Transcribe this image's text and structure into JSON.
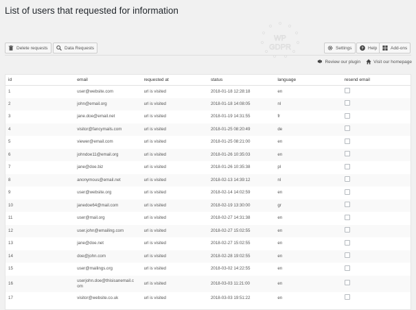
{
  "header": {
    "title": "List of users that requested for information",
    "logo_text_1": "WP",
    "logo_text_2": "GDPR"
  },
  "toolbar": {
    "delete_label": "Delete requests",
    "data_requests_label": "Data Requests",
    "settings_label": "Settings",
    "help_label": "Help",
    "addons_label": "Add-ons"
  },
  "links": {
    "review_label": "Review our plugin",
    "homepage_label": "Visit our homepage"
  },
  "table": {
    "columns": [
      "id",
      "email",
      "requested at",
      "status",
      "language",
      "resend email"
    ],
    "rows": [
      {
        "id": "1",
        "email": "user@website.com",
        "requested": "url is visited",
        "status": "2018-01-18 12:28:18",
        "language": "en"
      },
      {
        "id": "2",
        "email": "john@email.org",
        "requested": "url is visited",
        "status": "2018-01-18 14:08:05",
        "language": "nl"
      },
      {
        "id": "3",
        "email": "jane.doe@email.net",
        "requested": "url is visited",
        "status": "2018-01-19 14:31:55",
        "language": "fr"
      },
      {
        "id": "4",
        "email": "visitor@fancymails.com",
        "requested": "url is visited",
        "status": "2018-01-25 08:20:49",
        "language": "de"
      },
      {
        "id": "5",
        "email": "viewer@email.com",
        "requested": "url is visited",
        "status": "2018-01-25 08:21:00",
        "language": "en"
      },
      {
        "id": "6",
        "email": "johndoe11@email.org",
        "requested": "url is visited",
        "status": "2018-01-26 10:35:03",
        "language": "en"
      },
      {
        "id": "7",
        "email": "jane@doe.biz",
        "requested": "url is visited",
        "status": "2018-01-26 10:35:38",
        "language": "pl"
      },
      {
        "id": "8",
        "email": "anonymous@email.net",
        "requested": "url is visited",
        "status": "2018-02-13 14:39:12",
        "language": "nl"
      },
      {
        "id": "9",
        "email": "user@website.org",
        "requested": "url is visited",
        "status": "2018-02-14 14:02:59",
        "language": "en"
      },
      {
        "id": "10",
        "email": "janedoe64@mail.com",
        "requested": "url is visited",
        "status": "2018-02-19 13:30:00",
        "language": "gr"
      },
      {
        "id": "11",
        "email": "user@mail.org",
        "requested": "url is visited",
        "status": "2018-02-27 14:31:38",
        "language": "en"
      },
      {
        "id": "12",
        "email": "user.john@emailing.com",
        "requested": "url is visited",
        "status": "2018-02-27 15:02:55",
        "language": "en"
      },
      {
        "id": "13",
        "email": "jane@doe.net",
        "requested": "url is visited",
        "status": "2018-02-27 15:02:55",
        "language": "en"
      },
      {
        "id": "14",
        "email": "doe@john.com",
        "requested": "url is visited",
        "status": "2018-02-28 19:02:55",
        "language": "en"
      },
      {
        "id": "15",
        "email": "user@mailings.org",
        "requested": "url is visited",
        "status": "2018-03-02 14:22:55",
        "language": "en"
      },
      {
        "id": "16",
        "email": "userjohn.doe@thisisanemail.com",
        "email_line1": "userjohn.doe@thisisanemail.c",
        "email_line2": "om",
        "requested": "url is visited",
        "status": "2018-03-03 11:21:00",
        "language": "en"
      },
      {
        "id": "17",
        "email": "visitor@website.co.uk",
        "requested": "url is visited",
        "status": "2018-03-03 19:51:22",
        "language": "en"
      }
    ]
  },
  "colors": {
    "background": "#f1f1f1",
    "panel": "#ffffff",
    "text": "#555555",
    "title": "#23282d"
  },
  "icons": {
    "delete": "trash-icon",
    "data_requests": "search-icon",
    "settings": "gear-icon",
    "help": "help-icon",
    "addons": "grid-icon",
    "review": "megaphone-icon",
    "homepage": "home-icon"
  }
}
